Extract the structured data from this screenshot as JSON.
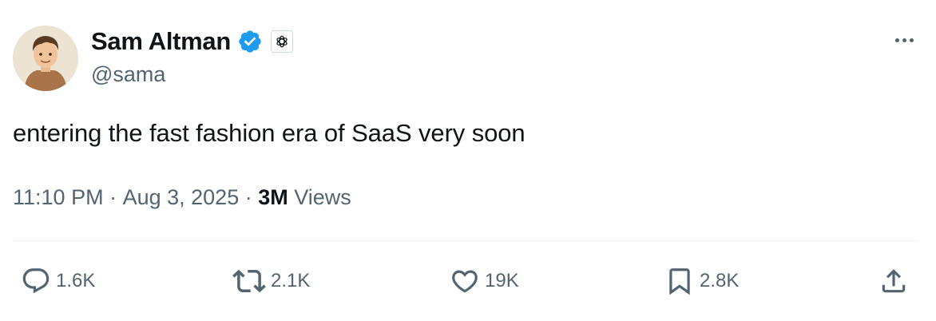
{
  "author": {
    "display_name": "Sam Altman",
    "handle": "@sama",
    "verified": true,
    "affiliate": "openai-logo-icon"
  },
  "tweet": {
    "text": "entering the fast fashion era of SaaS very soon",
    "time": "11:10 PM",
    "separator": " · ",
    "date": "Aug 3, 2025",
    "views_count": "3M",
    "views_label": " Views"
  },
  "actions": {
    "reply_count": "1.6K",
    "repost_count": "2.1K",
    "like_count": "19K",
    "bookmark_count": "2.8K"
  },
  "colors": {
    "verified": "#1d9bf0",
    "text_primary": "#0f1419",
    "text_secondary": "#536471",
    "divider": "#eff3f4"
  }
}
